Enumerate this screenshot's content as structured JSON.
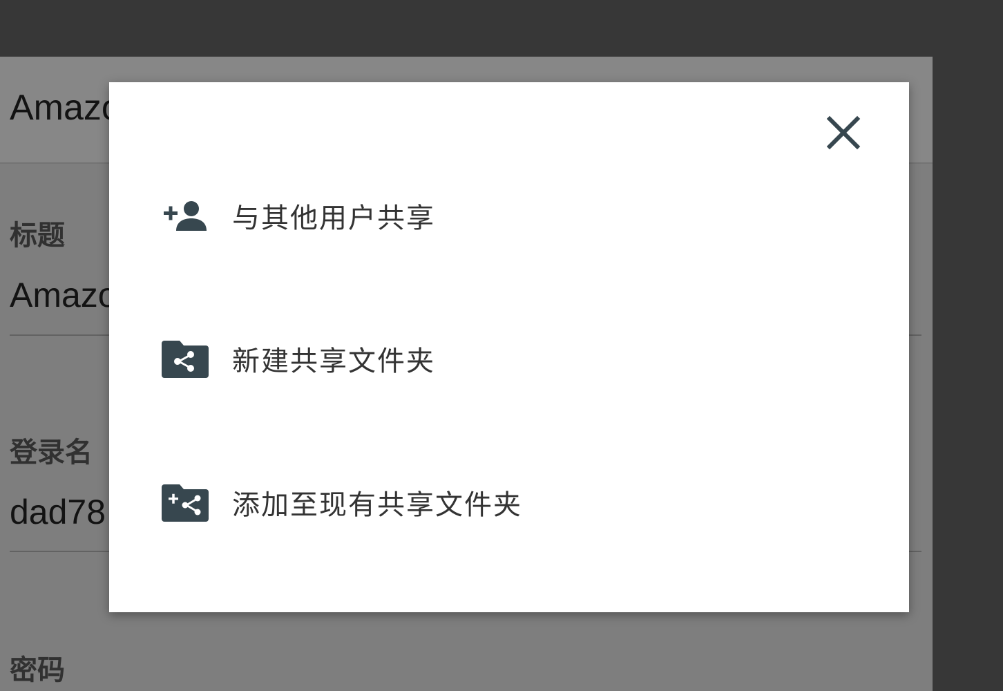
{
  "background": {
    "header_title": "Amazon",
    "fields": [
      {
        "label": "标题",
        "value": "Amazon"
      },
      {
        "label": "登录名",
        "value": "dad78"
      },
      {
        "label": "密码",
        "value": ""
      }
    ]
  },
  "modal": {
    "close_icon": "close-icon",
    "items": [
      {
        "label": "与其他用户共享",
        "icon": "add-person-icon"
      },
      {
        "label": "新建共享文件夹",
        "icon": "shared-folder-icon"
      },
      {
        "label": "添加至现有共享文件夹",
        "icon": "add-to-shared-folder-icon"
      }
    ]
  },
  "colors": {
    "icon": "#37474f",
    "text": "#333333",
    "overlay": "#5f5f5f"
  }
}
